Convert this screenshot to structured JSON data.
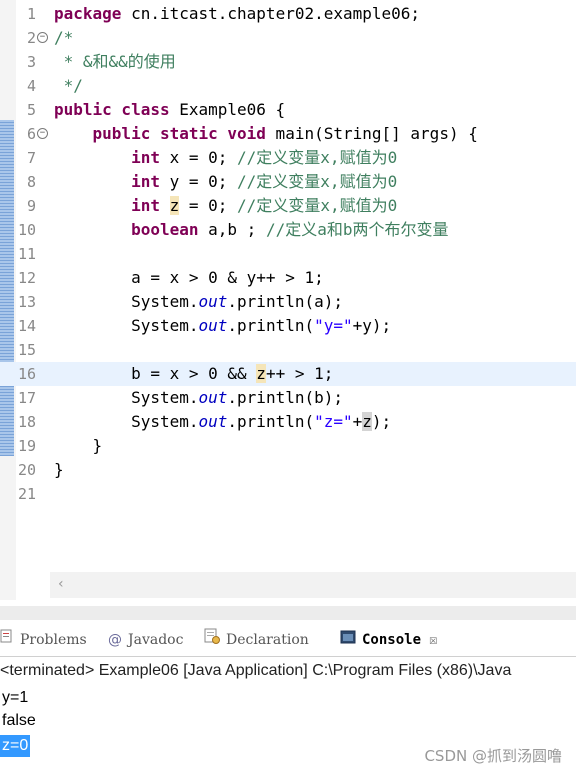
{
  "editor": {
    "lines": [
      {
        "n": "1",
        "html": "<span class=\"kw\">package</span> cn.itcast.chapter02.example06;"
      },
      {
        "n": "2",
        "html": "<span class=\"cm\">/*</span>"
      },
      {
        "n": "3",
        "html": "<span class=\"cm\"> * &amp;和&amp;&amp;的使用</span>"
      },
      {
        "n": "4",
        "html": "<span class=\"cm\"> */</span>"
      },
      {
        "n": "5",
        "html": "<span class=\"kw\">public class</span> Example06 {"
      },
      {
        "n": "6",
        "html": "    <span class=\"kw\">public static void</span> main(String[] args) {"
      },
      {
        "n": "7",
        "html": "        <span class=\"kw\">int</span> x = 0; <span class=\"cm\">//定义变量x,赋值为0</span>"
      },
      {
        "n": "8",
        "html": "        <span class=\"kw\">int</span> y = 0; <span class=\"cm\">//定义变量x,赋值为0</span>"
      },
      {
        "n": "9",
        "html": "        <span class=\"kw\">int</span> <span class=\"mark\">z</span> = 0; <span class=\"cm\">//定义变量x,赋值为0</span>"
      },
      {
        "n": "10",
        "html": "        <span class=\"kw\">boolean</span> a,b ; <span class=\"cm\">//定义a和b两个布尔变量</span>"
      },
      {
        "n": "11",
        "html": ""
      },
      {
        "n": "12",
        "html": "        a = x &gt; 0 &amp; y++ &gt; 1;"
      },
      {
        "n": "13",
        "html": "        System.<span class=\"fld\">out</span>.println(a);"
      },
      {
        "n": "14",
        "html": "        System.<span class=\"fld\">out</span>.println(<span class=\"st\">\"y=\"</span>+y);"
      },
      {
        "n": "15",
        "html": ""
      },
      {
        "n": "16",
        "html": "        b = x &gt; 0 &amp;&amp; <span class=\"mark\">z</span>++ &gt; 1;"
      },
      {
        "n": "17",
        "html": "        System.<span class=\"fld\">out</span>.println(b);"
      },
      {
        "n": "18",
        "html": "        System.<span class=\"fld\">out</span>.println(<span class=\"st\">\"z=\"</span>+<span class=\"mark2\">z</span>);"
      },
      {
        "n": "19",
        "html": "    }"
      },
      {
        "n": "20",
        "html": "}"
      },
      {
        "n": "21",
        "html": ""
      }
    ]
  },
  "tabs": {
    "problems": "Problems",
    "javadoc": "Javadoc",
    "declaration": "Declaration",
    "console": "Console"
  },
  "console": {
    "status": "<terminated> Example06 [Java Application] C:\\Program Files (x86)\\Java",
    "output": [
      "y=1",
      "false",
      "z=0"
    ]
  },
  "watermark": "CSDN @抓到汤圆噜"
}
